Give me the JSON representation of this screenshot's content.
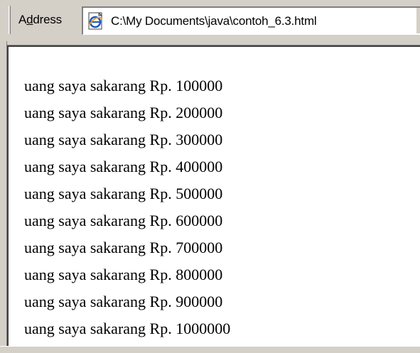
{
  "address_bar": {
    "label": "Address",
    "value": "C:\\My Documents\\java\\contoh_6.3.html",
    "icon": "ie-page-icon"
  },
  "page_content": {
    "lines": [
      "uang saya sakarang Rp. 100000",
      "uang saya sakarang Rp. 200000",
      "uang saya sakarang Rp. 300000",
      "uang saya sakarang Rp. 400000",
      "uang saya sakarang Rp. 500000",
      "uang saya sakarang Rp. 600000",
      "uang saya sakarang Rp. 700000",
      "uang saya sakarang Rp. 800000",
      "uang saya sakarang Rp. 900000",
      "uang saya sakarang Rp. 1000000"
    ]
  },
  "colors": {
    "chrome": "#d4d0c8",
    "shadow": "#808080",
    "text": "#000000",
    "background": "#ffffff"
  }
}
